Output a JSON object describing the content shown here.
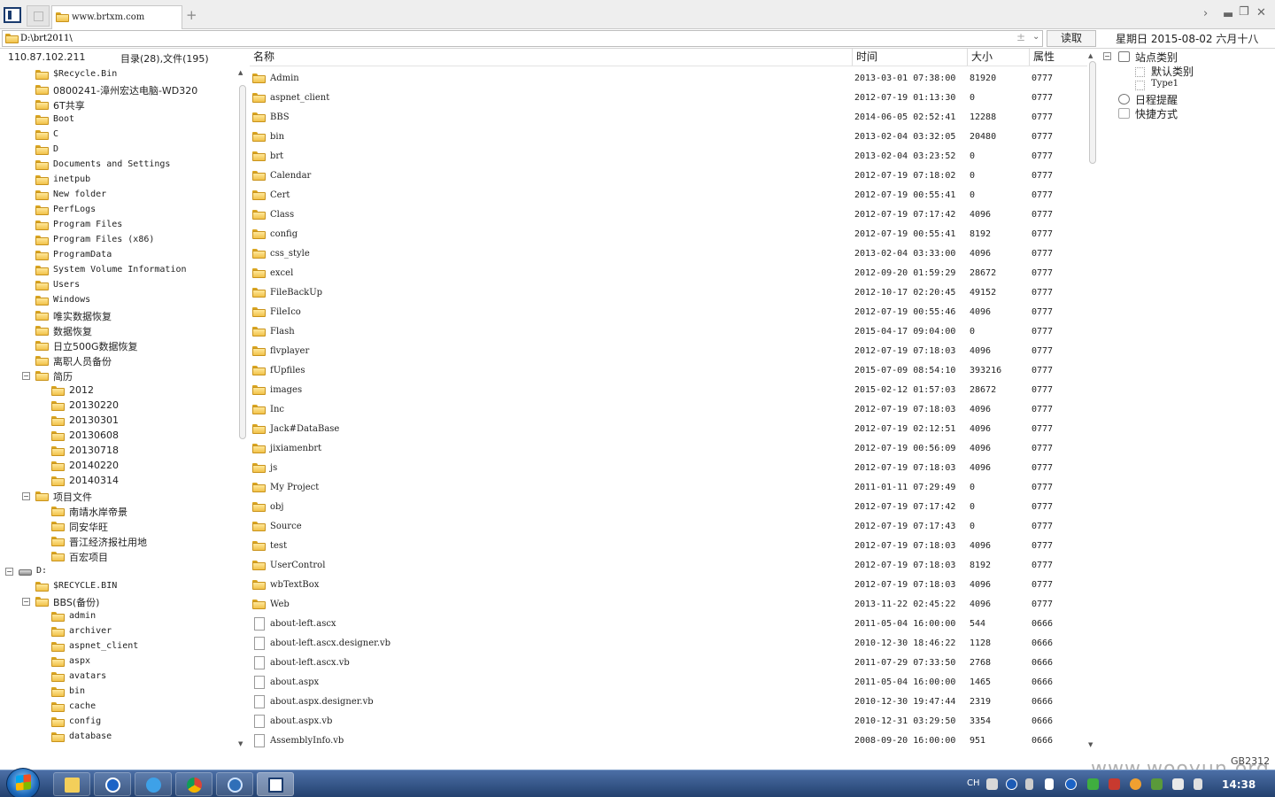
{
  "tab": {
    "title": "www.brtxm.com"
  },
  "address": {
    "path": "D:\\brt2011\\",
    "read_label": "读取",
    "date_text": "星期日 2015-08-02 六月十八"
  },
  "info": {
    "ip": "110.87.102.211",
    "counts": "目录(28),文件(195)"
  },
  "columns": {
    "name": "名称",
    "time": "时间",
    "size": "大小",
    "attr": "属性"
  },
  "tree": [
    {
      "label": "$Recycle.Bin",
      "cjk": false
    },
    {
      "label": "0800241-漳州宏达电脑-WD320",
      "cjk": true
    },
    {
      "label": "6T共享",
      "cjk": true
    },
    {
      "label": "Boot",
      "cjk": false
    },
    {
      "label": "C",
      "cjk": false
    },
    {
      "label": "D",
      "cjk": false
    },
    {
      "label": "Documents and Settings",
      "cjk": false
    },
    {
      "label": "inetpub",
      "cjk": false
    },
    {
      "label": "New folder",
      "cjk": false
    },
    {
      "label": "PerfLogs",
      "cjk": false
    },
    {
      "label": "Program Files",
      "cjk": false
    },
    {
      "label": "Program Files (x86)",
      "cjk": false
    },
    {
      "label": "ProgramData",
      "cjk": false
    },
    {
      "label": "System Volume Information",
      "cjk": false
    },
    {
      "label": "Users",
      "cjk": false
    },
    {
      "label": "Windows",
      "cjk": false
    },
    {
      "label": "唯实数据恢复",
      "cjk": true
    },
    {
      "label": "数据恢复",
      "cjk": true
    },
    {
      "label": "日立500G数据恢复",
      "cjk": true
    },
    {
      "label": "离职人员备份",
      "cjk": true
    },
    {
      "label": "简历",
      "cjk": true,
      "toggle": "−"
    },
    {
      "label": "2012",
      "cjk": true,
      "indent": 1
    },
    {
      "label": "20130220",
      "cjk": true,
      "indent": 1
    },
    {
      "label": "20130301",
      "cjk": true,
      "indent": 1
    },
    {
      "label": "20130608",
      "cjk": true,
      "indent": 1
    },
    {
      "label": "20130718",
      "cjk": true,
      "indent": 1
    },
    {
      "label": "20140220",
      "cjk": true,
      "indent": 1
    },
    {
      "label": "20140314",
      "cjk": true,
      "indent": 1
    },
    {
      "label": "项目文件",
      "cjk": true,
      "toggle": "−"
    },
    {
      "label": "南靖水岸帝景",
      "cjk": true,
      "indent": 1
    },
    {
      "label": "同安华旺",
      "cjk": true,
      "indent": 1
    },
    {
      "label": "晋江经济报社用地",
      "cjk": true,
      "indent": 1
    },
    {
      "label": "百宏项目",
      "cjk": true,
      "indent": 1
    },
    {
      "label": "D:",
      "cjk": false,
      "drive": true,
      "toggle": "−"
    },
    {
      "label": "$RECYCLE.BIN",
      "cjk": false
    },
    {
      "label": "BBS(备份)",
      "cjk": true,
      "toggle": "−"
    },
    {
      "label": "admin",
      "cjk": false,
      "indent": 1
    },
    {
      "label": "archiver",
      "cjk": false,
      "indent": 1
    },
    {
      "label": "aspnet_client",
      "cjk": false,
      "indent": 1
    },
    {
      "label": "aspx",
      "cjk": false,
      "indent": 1
    },
    {
      "label": "avatars",
      "cjk": false,
      "indent": 1
    },
    {
      "label": "bin",
      "cjk": false,
      "indent": 1
    },
    {
      "label": "cache",
      "cjk": false,
      "indent": 1
    },
    {
      "label": "config",
      "cjk": false,
      "indent": 1
    },
    {
      "label": "database",
      "cjk": false,
      "indent": 1
    }
  ],
  "files": [
    {
      "name": "Admin",
      "time": "2013-03-01 07:38:00",
      "size": "81920",
      "attr": "0777",
      "type": "folder"
    },
    {
      "name": "aspnet_client",
      "time": "2012-07-19 01:13:30",
      "size": "0",
      "attr": "0777",
      "type": "folder"
    },
    {
      "name": "BBS",
      "time": "2014-06-05 02:52:41",
      "size": "12288",
      "attr": "0777",
      "type": "folder"
    },
    {
      "name": "bin",
      "time": "2013-02-04 03:32:05",
      "size": "20480",
      "attr": "0777",
      "type": "folder"
    },
    {
      "name": "brt",
      "time": "2013-02-04 03:23:52",
      "size": "0",
      "attr": "0777",
      "type": "folder"
    },
    {
      "name": "Calendar",
      "time": "2012-07-19 07:18:02",
      "size": "0",
      "attr": "0777",
      "type": "folder"
    },
    {
      "name": "Cert",
      "time": "2012-07-19 00:55:41",
      "size": "0",
      "attr": "0777",
      "type": "folder"
    },
    {
      "name": "Class",
      "time": "2012-07-19 07:17:42",
      "size": "4096",
      "attr": "0777",
      "type": "folder"
    },
    {
      "name": "config",
      "time": "2012-07-19 00:55:41",
      "size": "8192",
      "attr": "0777",
      "type": "folder"
    },
    {
      "name": "css_style",
      "time": "2013-02-04 03:33:00",
      "size": "4096",
      "attr": "0777",
      "type": "folder"
    },
    {
      "name": "excel",
      "time": "2012-09-20 01:59:29",
      "size": "28672",
      "attr": "0777",
      "type": "folder"
    },
    {
      "name": "FileBackUp",
      "time": "2012-10-17 02:20:45",
      "size": "49152",
      "attr": "0777",
      "type": "folder"
    },
    {
      "name": "FileIco",
      "time": "2012-07-19 00:55:46",
      "size": "4096",
      "attr": "0777",
      "type": "folder"
    },
    {
      "name": "Flash",
      "time": "2015-04-17 09:04:00",
      "size": "0",
      "attr": "0777",
      "type": "folder"
    },
    {
      "name": "flvplayer",
      "time": "2012-07-19 07:18:03",
      "size": "4096",
      "attr": "0777",
      "type": "folder"
    },
    {
      "name": "fUpfiles",
      "time": "2015-07-09 08:54:10",
      "size": "393216",
      "attr": "0777",
      "type": "folder"
    },
    {
      "name": "images",
      "time": "2015-02-12 01:57:03",
      "size": "28672",
      "attr": "0777",
      "type": "folder"
    },
    {
      "name": "Inc",
      "time": "2012-07-19 07:18:03",
      "size": "4096",
      "attr": "0777",
      "type": "folder"
    },
    {
      "name": "Jack#DataBase",
      "time": "2012-07-19 02:12:51",
      "size": "4096",
      "attr": "0777",
      "type": "folder"
    },
    {
      "name": "jixiamenbrt",
      "time": "2012-07-19 00:56:09",
      "size": "4096",
      "attr": "0777",
      "type": "folder"
    },
    {
      "name": "js",
      "time": "2012-07-19 07:18:03",
      "size": "4096",
      "attr": "0777",
      "type": "folder"
    },
    {
      "name": "My Project",
      "time": "2011-01-11 07:29:49",
      "size": "0",
      "attr": "0777",
      "type": "folder"
    },
    {
      "name": "obj",
      "time": "2012-07-19 07:17:42",
      "size": "0",
      "attr": "0777",
      "type": "folder"
    },
    {
      "name": "Source",
      "time": "2012-07-19 07:17:43",
      "size": "0",
      "attr": "0777",
      "type": "folder"
    },
    {
      "name": "test",
      "time": "2012-07-19 07:18:03",
      "size": "4096",
      "attr": "0777",
      "type": "folder"
    },
    {
      "name": "UserControl",
      "time": "2012-07-19 07:18:03",
      "size": "8192",
      "attr": "0777",
      "type": "folder"
    },
    {
      "name": "wbTextBox",
      "time": "2012-07-19 07:18:03",
      "size": "4096",
      "attr": "0777",
      "type": "folder"
    },
    {
      "name": "Web",
      "time": "2013-11-22 02:45:22",
      "size": "4096",
      "attr": "0777",
      "type": "folder"
    },
    {
      "name": "about-left.ascx",
      "time": "2011-05-04 16:00:00",
      "size": "544",
      "attr": "0666",
      "type": "file"
    },
    {
      "name": "about-left.ascx.designer.vb",
      "time": "2010-12-30 18:46:22",
      "size": "1128",
      "attr": "0666",
      "type": "file"
    },
    {
      "name": "about-left.ascx.vb",
      "time": "2011-07-29 07:33:50",
      "size": "2768",
      "attr": "0666",
      "type": "file"
    },
    {
      "name": "about.aspx",
      "time": "2011-05-04 16:00:00",
      "size": "1465",
      "attr": "0666",
      "type": "file"
    },
    {
      "name": "about.aspx.designer.vb",
      "time": "2010-12-30 19:47:44",
      "size": "2319",
      "attr": "0666",
      "type": "file"
    },
    {
      "name": "about.aspx.vb",
      "time": "2010-12-31 03:29:50",
      "size": "3354",
      "attr": "0666",
      "type": "file"
    },
    {
      "name": "AssemblyInfo.vb",
      "time": "2008-09-20 16:00:00",
      "size": "951",
      "attr": "0666",
      "type": "file"
    }
  ],
  "right_panel": {
    "site_category": "站点类别",
    "default_category": "默认类别",
    "type1": "Type1",
    "schedule": "日程提醒",
    "shortcut": "快捷方式"
  },
  "status": {
    "encoding": "GB2312",
    "watermark": "www.wooyun.org"
  },
  "taskbar": {
    "ime": "CH",
    "clock": "14:38"
  }
}
